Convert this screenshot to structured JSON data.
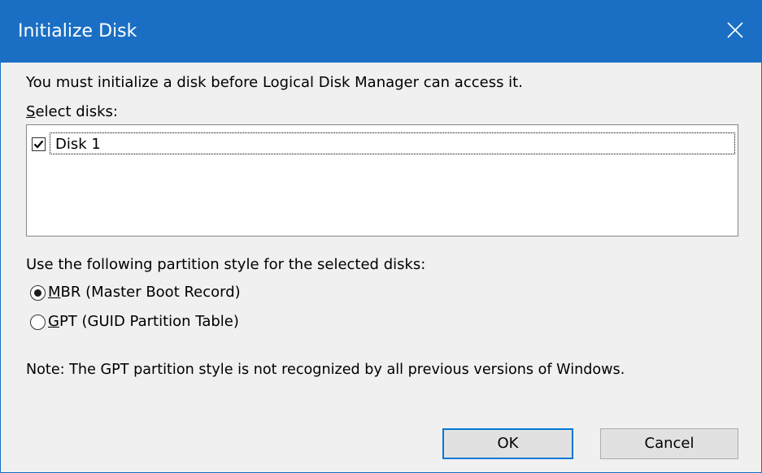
{
  "window": {
    "title": "Initialize Disk",
    "accent_color": "#1a6fc4",
    "close_icon": "close-icon"
  },
  "instructions": {
    "intro": "You must initialize a disk before Logical Disk Manager can access it.",
    "select_label_mnemonic": "S",
    "select_label_rest": "elect disks:"
  },
  "disks": [
    {
      "label": "Disk 1",
      "checked": true
    }
  ],
  "partition": {
    "prompt": "Use the following partition style for the selected disks:",
    "options": [
      {
        "mnemonic": "M",
        "rest": "BR (Master Boot Record)",
        "selected": true
      },
      {
        "mnemonic": "G",
        "rest": "PT (GUID Partition Table)",
        "selected": false
      }
    ]
  },
  "note": "Note: The GPT partition style is not recognized by all previous versions of Windows.",
  "buttons": {
    "ok": "OK",
    "cancel": "Cancel"
  }
}
